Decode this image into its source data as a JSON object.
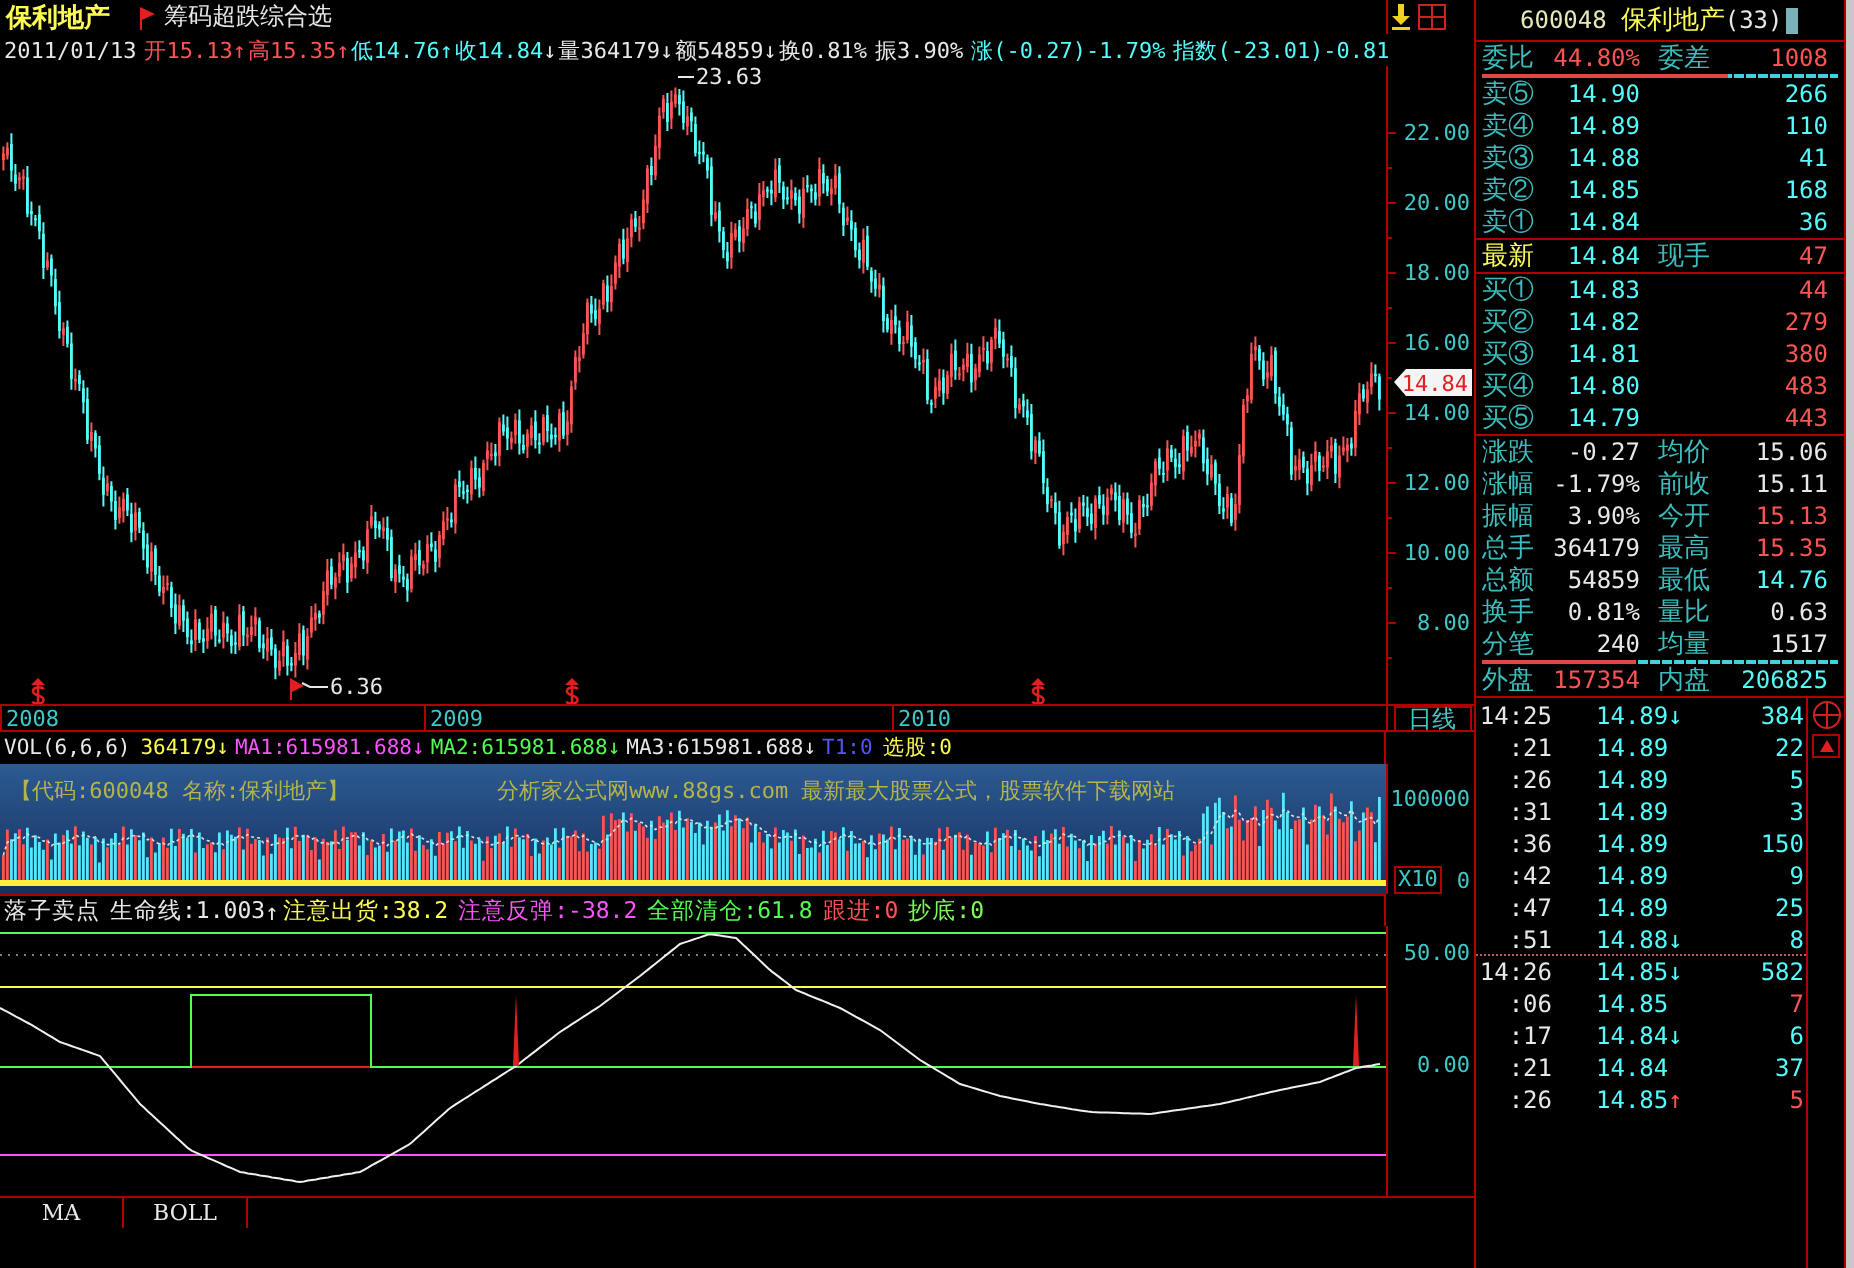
{
  "title_bar": {
    "stock_name": "保利地产",
    "indicator": "筹码超跌综合选"
  },
  "quote_bar": [
    {
      "text": "2011/01/13",
      "color": "#e8e8e8"
    },
    {
      "text": "开15.13",
      "color": "#fc5454",
      "arrow": {
        "text": "↑",
        "color": "#fc5454"
      }
    },
    {
      "text": "高15.35",
      "color": "#fc5454",
      "arrow": {
        "text": "↑",
        "color": "#fc5454"
      }
    },
    {
      "text": "低14.76",
      "color": "#54fcfc",
      "arrow": {
        "text": "↑",
        "color": "#54fcfc"
      }
    },
    {
      "text": "收14.84",
      "color": "#54fcfc",
      "arrow": {
        "text": "↓",
        "color": "#e8e8e8"
      }
    },
    {
      "text": "量364179",
      "color": "#e8e8e8",
      "arrow": {
        "text": "↓",
        "color": "#e8e8e8"
      }
    },
    {
      "text": "额54859",
      "color": "#e8e8e8",
      "arrow": {
        "text": "↓",
        "color": "#e8e8e8"
      }
    },
    {
      "text": "换0.81%",
      "color": "#e8e8e8"
    },
    {
      "text": "振3.90%",
      "color": "#e8e8e8"
    },
    {
      "text": "涨(-0.27)-1.79%",
      "color": "#54fcfc"
    },
    {
      "text": "指数(-23.01)-0.81",
      "color": "#54fcfc"
    }
  ],
  "price_chart": {
    "high_label": "23.63",
    "low_label": "6.36",
    "axis_labels": [
      "22.00",
      "20.00",
      "18.00",
      "16.00",
      "14.00",
      "12.00",
      "10.00",
      "8.00"
    ],
    "current_price": "14.84"
  },
  "date_axis": {
    "years": [
      "2008",
      "2009",
      "2010"
    ],
    "period": "日线"
  },
  "volume_panel": {
    "legend": [
      {
        "text": "VOL(6,6,6)",
        "color": "#e8e8e8"
      },
      {
        "text": "364179",
        "color": "#fcfc54",
        "arrow": "↓"
      },
      {
        "text": "MA1:615981.688",
        "color": "#fc54fc",
        "arrow": "↓"
      },
      {
        "text": "MA2:615981.688",
        "color": "#54fc54",
        "arrow": "↓"
      },
      {
        "text": "MA3:615981.688",
        "color": "#e8e8e8",
        "arrow": "↓"
      },
      {
        "text": "T1:0",
        "color": "#5454fc"
      },
      {
        "text": "选股:0",
        "color": "#fcfc54"
      }
    ],
    "notes": [
      "【代码:600048 名称:保利地产】",
      "分析家公式网www.88gs.com 最新最大股票公式，股票软件下载网站"
    ],
    "axis_labels": [
      "100000",
      "0"
    ],
    "scale": "X10"
  },
  "indicator_panel": {
    "legend": [
      {
        "text": "落子卖点",
        "color": "#e8e8e8"
      },
      {
        "text": "生命线:1.003",
        "color": "#e8e8e8",
        "arrow": "↑"
      },
      {
        "text": "注意出货:38.2",
        "color": "#fcfc54"
      },
      {
        "text": "注意反弹:-38.2",
        "color": "#fc54fc"
      },
      {
        "text": "全部清仓:61.8",
        "color": "#54fc54"
      },
      {
        "text": "跟进:0",
        "color": "#fc5454"
      },
      {
        "text": "抄底:0",
        "color": "#7cfc54"
      }
    ],
    "axis_labels": [
      "50.00",
      "0.00"
    ]
  },
  "tabs": [
    {
      "label": "MA",
      "selected": false
    },
    {
      "label": "BOLL",
      "selected": false
    }
  ],
  "quote_panel": {
    "code": "600048",
    "name": "保利地产",
    "count": "(33)",
    "ratio": {
      "label": "委比",
      "value": "44.80%",
      "diff_label": "委差",
      "diff": "1008",
      "level": 0.69
    },
    "asks": [
      {
        "label": "卖⑤",
        "price": "14.90",
        "volume": "266"
      },
      {
        "label": "卖④",
        "price": "14.89",
        "volume": "110"
      },
      {
        "label": "卖③",
        "price": "14.88",
        "volume": "41"
      },
      {
        "label": "卖②",
        "price": "14.85",
        "volume": "168"
      },
      {
        "label": "卖①",
        "price": "14.84",
        "volume": "36"
      }
    ],
    "last": {
      "label": "最新",
      "price": "14.84",
      "hand_label": "现手",
      "hand": "47"
    },
    "bids": [
      {
        "label": "买①",
        "price": "14.83",
        "volume": "44"
      },
      {
        "label": "买②",
        "price": "14.82",
        "volume": "279"
      },
      {
        "label": "买③",
        "price": "14.81",
        "volume": "380"
      },
      {
        "label": "买④",
        "price": "14.80",
        "volume": "483"
      },
      {
        "label": "买⑤",
        "price": "14.79",
        "volume": "443"
      }
    ],
    "stats": [
      {
        "label": "涨跌",
        "value": "-0.27",
        "color": "#e8e8e8"
      },
      {
        "label": "均价",
        "value": "15.06",
        "color": "#e8e8e8"
      },
      {
        "label": "涨幅",
        "value": "-1.79%",
        "color": "#e8e8e8"
      },
      {
        "label": "前收",
        "value": "15.11",
        "color": "#e8e8e8"
      },
      {
        "label": "振幅",
        "value": "3.90%",
        "color": "#e8e8e8"
      },
      {
        "label": "今开",
        "value": "15.13",
        "color": "#fc5454"
      },
      {
        "label": "总手",
        "value": "364179",
        "color": "#e8e8e8"
      },
      {
        "label": "最高",
        "value": "15.35",
        "color": "#fc5454"
      },
      {
        "label": "总额",
        "value": "54859",
        "color": "#e8e8e8"
      },
      {
        "label": "最低",
        "value": "14.76",
        "color": "#54fcfc"
      },
      {
        "label": "换手",
        "value": "0.81%",
        "color": "#e8e8e8"
      },
      {
        "label": "量比",
        "value": "0.63",
        "color": "#e8e8e8"
      },
      {
        "label": "分笔",
        "value": "240",
        "color": "#e8e8e8"
      },
      {
        "label": "均量",
        "value": "1517",
        "color": "#e8e8e8"
      }
    ],
    "flow": {
      "outer_label": "外盘",
      "outer": "157354",
      "inner_label": "内盘",
      "inner": "206825",
      "level": 0.43
    }
  },
  "trades": [
    {
      "time": "14:25",
      "price": "14.89",
      "arrow": {
        "text": "↓",
        "color": "#54fcfc"
      },
      "volume": "384",
      "color": "#54fcfc",
      "divider_above": false
    },
    {
      "time": ":21",
      "price": "14.89",
      "volume": "22",
      "color": "#54fcfc",
      "divider_above": false
    },
    {
      "time": ":26",
      "price": "14.89",
      "volume": "5",
      "color": "#54fcfc",
      "divider_above": false
    },
    {
      "time": ":31",
      "price": "14.89",
      "volume": "3",
      "color": "#54fcfc",
      "divider_above": false
    },
    {
      "time": ":36",
      "price": "14.89",
      "volume": "150",
      "color": "#54fcfc",
      "divider_above": false
    },
    {
      "time": ":42",
      "price": "14.89",
      "volume": "9",
      "color": "#54fcfc",
      "divider_above": false
    },
    {
      "time": ":47",
      "price": "14.89",
      "volume": "25",
      "color": "#54fcfc",
      "divider_above": false
    },
    {
      "time": ":51",
      "price": "14.88",
      "arrow": {
        "text": "↓",
        "color": "#54fcfc"
      },
      "volume": "8",
      "color": "#54fcfc",
      "divider_above": false
    },
    {
      "time": "14:26",
      "price": "14.85",
      "arrow": {
        "text": "↓",
        "color": "#54fcfc"
      },
      "volume": "582",
      "color": "#54fcfc",
      "divider_above": true
    },
    {
      "time": ":06",
      "price": "14.85",
      "volume": "7",
      "color": "#fc5454",
      "divider_above": false
    },
    {
      "time": ":17",
      "price": "14.84",
      "arrow": {
        "text": "↓",
        "color": "#54fcfc"
      },
      "volume": "6",
      "color": "#54fcfc",
      "divider_above": false
    },
    {
      "time": ":21",
      "price": "14.84",
      "volume": "37",
      "color": "#54fcfc",
      "divider_above": false
    },
    {
      "time": ":26",
      "price": "14.85",
      "arrow": {
        "text": "↑",
        "color": "#fc5454"
      },
      "volume": "5",
      "color": "#fc5454",
      "divider_above": false
    }
  ]
}
